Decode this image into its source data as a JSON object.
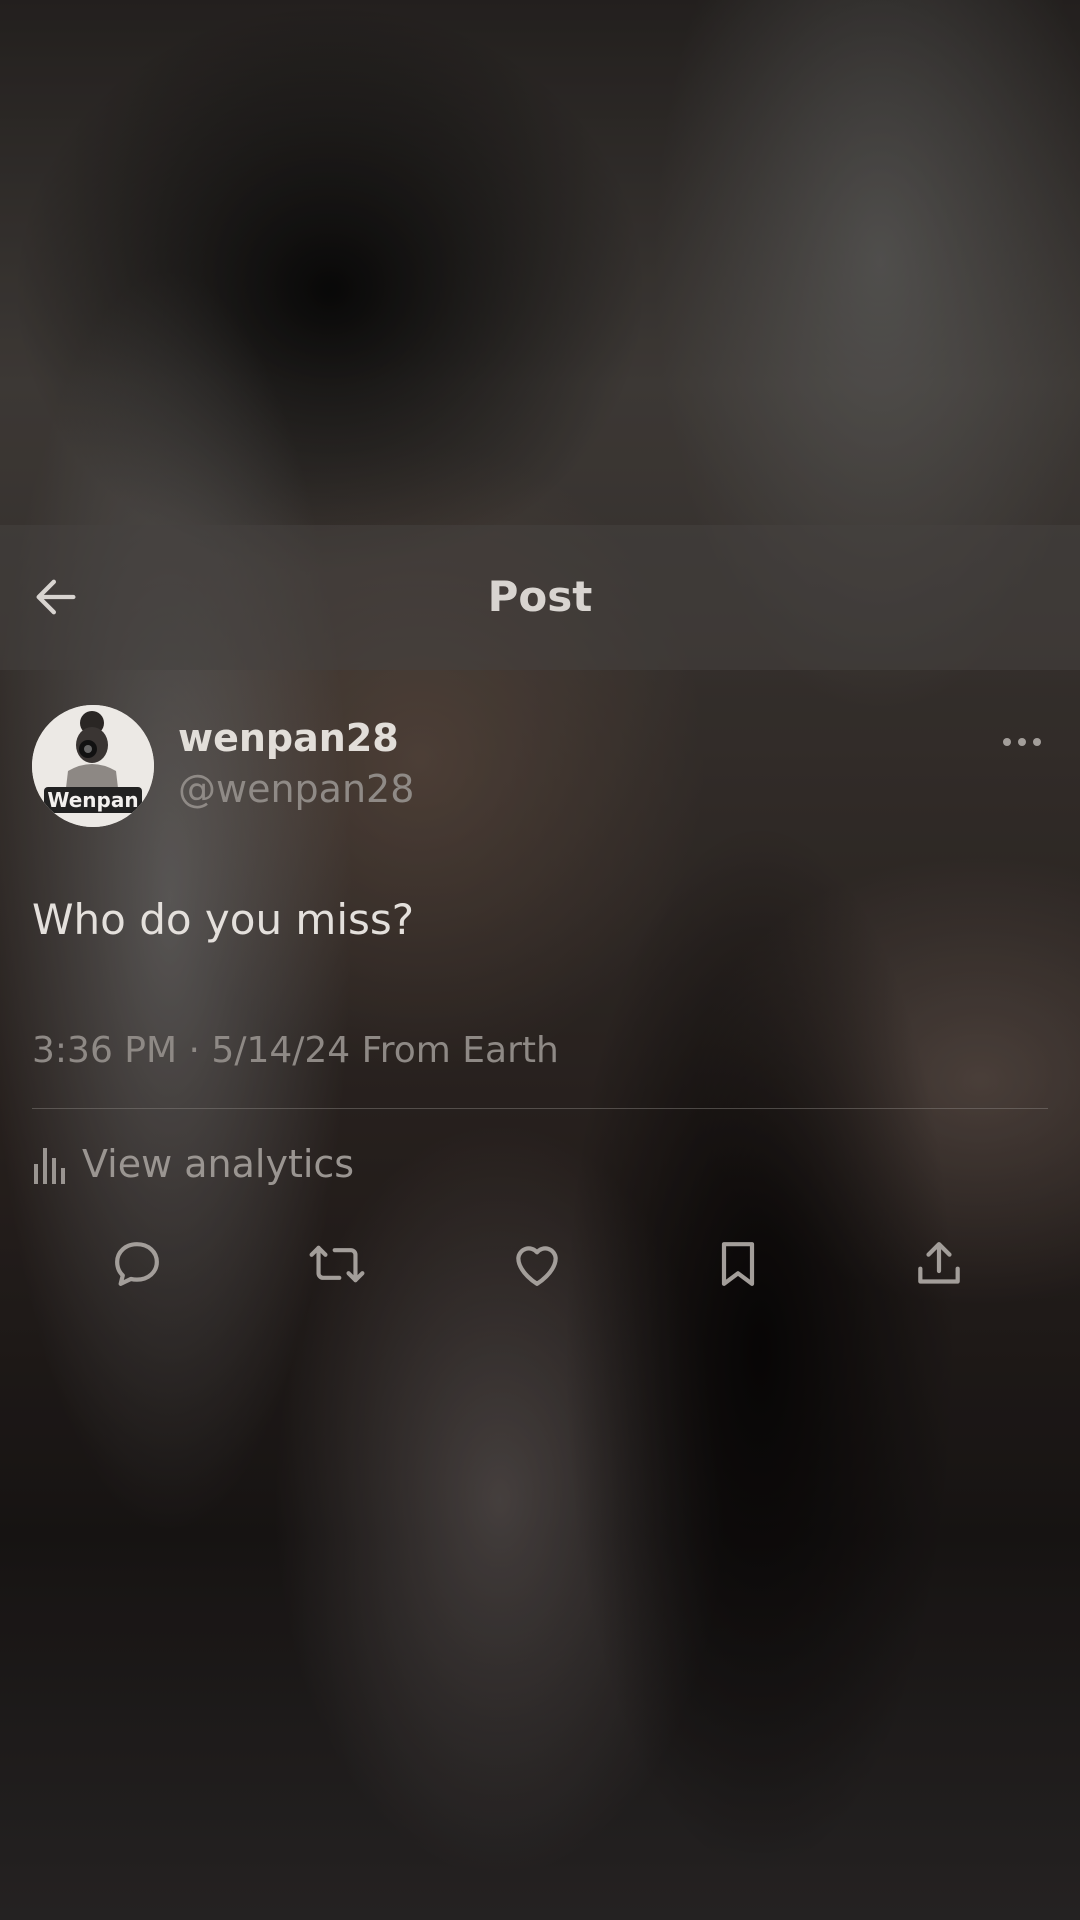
{
  "header": {
    "title": "Post"
  },
  "post": {
    "author_name": "wenpan28",
    "author_handle": "@wenpan28",
    "avatar_label": "Wenpan",
    "text": "Who do you miss?",
    "time": "3:36 PM",
    "date": "5/14/24",
    "location": "From Earth",
    "separator": "·"
  },
  "analytics": {
    "label": "View analytics"
  },
  "actions": [
    {
      "icon": "reply-icon"
    },
    {
      "icon": "repost-icon"
    },
    {
      "icon": "like-icon"
    },
    {
      "icon": "bookmark-icon"
    },
    {
      "icon": "share-icon"
    }
  ],
  "colors": {
    "text_primary": "#e2ded9",
    "text_secondary": "#8f8a86",
    "icon": "#a39e9a"
  }
}
